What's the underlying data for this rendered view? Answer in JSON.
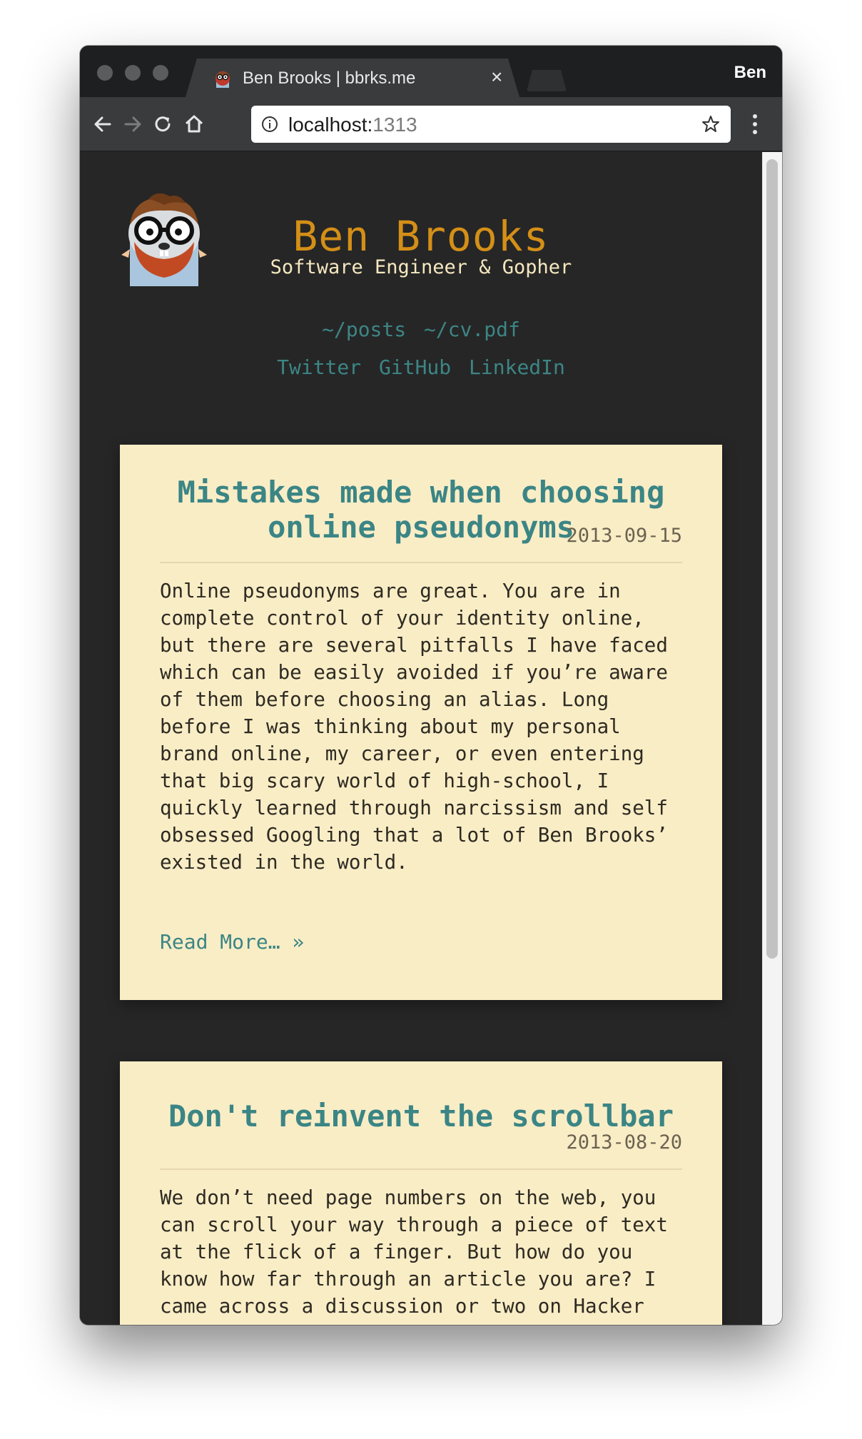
{
  "browser": {
    "tab_title": "Ben Brooks | bbrks.me",
    "tab_close": "×",
    "profile_name": "Ben",
    "url_host": "localhost:",
    "url_port": "1313"
  },
  "site": {
    "name": "Ben Brooks",
    "tagline": "Software Engineer & Gopher",
    "nav_primary": [
      "~/posts",
      "~/cv.pdf"
    ],
    "nav_social": [
      "Twitter",
      "GitHub",
      "LinkedIn"
    ]
  },
  "posts": [
    {
      "title": "Mistakes made when choosing online pseudonyms",
      "date": "2013-09-15",
      "excerpt_lines": [
        "Online pseudonyms are great. You are in",
        "complete control of your identity online,",
        "but there are several pitfalls I have faced",
        "which can be easily avoided if you’re aware",
        "of them before choosing an alias. Long",
        "before I was thinking about my personal",
        "brand online, my career, or even entering",
        "that big scary world of high-school, I",
        "quickly learned through narcissism and self",
        "obsessed Googling that a lot of Ben Brooks’",
        "existed in the world."
      ],
      "read_more": "Read More… »"
    },
    {
      "title": "Don't reinvent the scrollbar",
      "date": "2013-08-20",
      "excerpt_lines": [
        "We don’t need page numbers on the web, you",
        "can scroll your way through a piece of text",
        "at the flick of a finger. But how do you",
        "know how far through an article you are? I",
        "came across a discussion or two on Hacker"
      ]
    }
  ],
  "colors": {
    "accent_orange": "#d48f17",
    "link_teal": "#3d8585",
    "card_bg": "#f9edc6",
    "page_bg": "#262626"
  }
}
